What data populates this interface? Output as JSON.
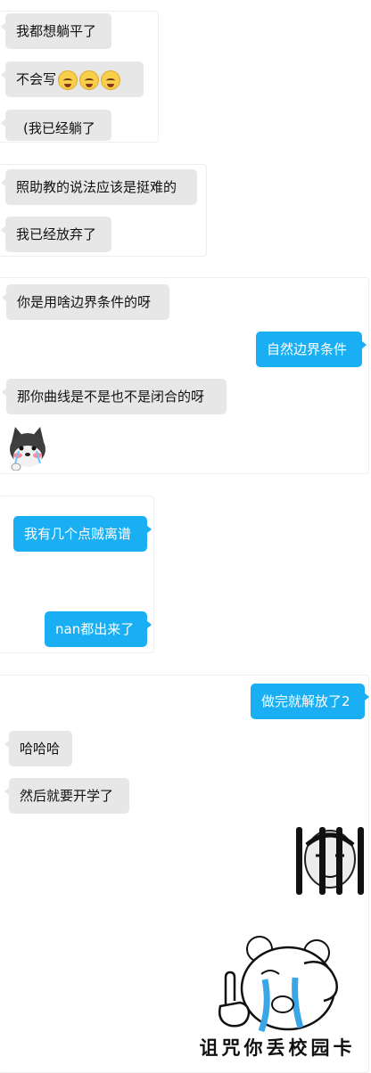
{
  "cards": [
    {
      "messages": [
        {
          "sender": "them",
          "text": "我都想躺平了"
        },
        {
          "sender": "them",
          "text": "不会写",
          "emoji": [
            "yawning-face-icon",
            "yawning-face-icon",
            "yawning-face-icon"
          ]
        },
        {
          "sender": "them",
          "text": "(我已经躺了"
        }
      ]
    },
    {
      "messages": [
        {
          "sender": "them",
          "text": "照助教的说法应该是挺难的"
        },
        {
          "sender": "them",
          "text": "我已经放弃了"
        }
      ]
    },
    {
      "messages": [
        {
          "sender": "them",
          "text": "你是用啥边界条件的呀"
        },
        {
          "sender": "me",
          "text": "自然边界条件"
        },
        {
          "sender": "them",
          "text": "那你曲线是不是也不是闭合的呀"
        },
        {
          "sender": "them",
          "sticker": "crying-shiba-dog-sticker"
        }
      ]
    },
    {
      "messages": [
        {
          "sender": "me",
          "text": "我有几个点贼离谱"
        },
        {
          "sender": "me",
          "text": "nan都出来了"
        }
      ]
    },
    {
      "messages": [
        {
          "sender": "me",
          "text": "做完就解放了2"
        },
        {
          "sender": "them",
          "text": "哈哈哈"
        },
        {
          "sender": "them",
          "text": "然后就要开学了"
        },
        {
          "sender": "me",
          "sticker": "behind-bars-face-sticker"
        },
        {
          "sender": "me",
          "sticker": "crying-bear-middle-finger-sticker",
          "caption": "诅咒你丢校园卡"
        }
      ]
    }
  ],
  "colors": {
    "incoming_bubble": "#e7e7e7",
    "outgoing_bubble": "#1aaef2",
    "card_border": "#eeeeee"
  }
}
